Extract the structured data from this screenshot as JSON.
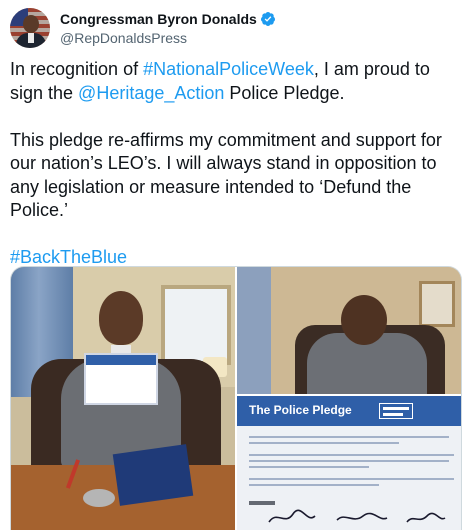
{
  "tweet": {
    "author": {
      "display_name": "Congressman Byron Donalds",
      "handle": "@RepDonaldsPress",
      "verified_icon": "verified-badge-icon"
    },
    "body": {
      "p1_before": "In recognition of ",
      "p1_hashtag": "#NationalPoliceWeek",
      "p1_middle": ", I am proud to sign the ",
      "p1_mention": "@Heritage_Action",
      "p1_after": " Police Pledge.",
      "p2": "This pledge re-affirms my commitment and support for our nation’s LEO’s. I will always stand in opposition to any legislation or measure intended to ‘Defund the Police.’",
      "p3_hashtag": "#BackTheBlue"
    },
    "media": {
      "pledge_document_title": "The Police Pledge"
    }
  },
  "colors": {
    "text": "#0f1419",
    "secondary": "#536471",
    "link": "#1d9bf0",
    "verified": "#1d9bf0",
    "pledge_blue": "#2f5fa8"
  }
}
